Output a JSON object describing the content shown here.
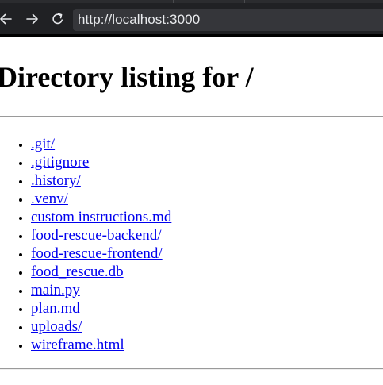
{
  "browser": {
    "url": "http://localhost:3000",
    "icons": {
      "back": "arrow-left-icon",
      "forward": "arrow-right-icon",
      "reload": "reload-icon"
    },
    "colors": {
      "chrome": "#202124",
      "address_bar": "#35363a",
      "address_text": "#e8eaed"
    }
  },
  "page": {
    "heading": "Directory listing for /",
    "entries": [
      ".git/",
      ".gitignore",
      ".history/",
      ".venv/",
      "custom instructions.md",
      "food-rescue-backend/",
      "food-rescue-frontend/",
      "food_rescue.db",
      "main.py",
      "plan.md",
      "uploads/",
      "wireframe.html"
    ],
    "colors": {
      "link": "#0000ee",
      "background": "#ffffff"
    }
  }
}
